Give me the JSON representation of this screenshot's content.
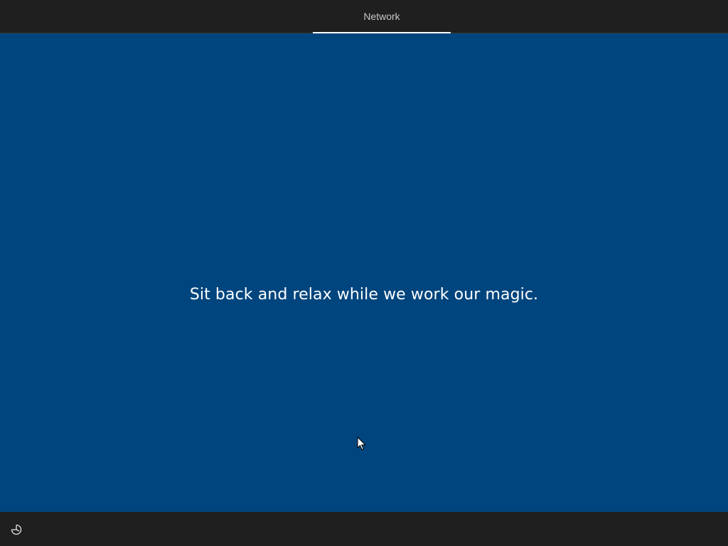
{
  "header": {
    "tabs": [
      {
        "label": "Network",
        "active": true
      }
    ]
  },
  "main": {
    "message": "Sit back and relax while we work our magic."
  },
  "footer": {
    "accessibility_icon": "ease-of-access-icon"
  },
  "colors": {
    "background": "#00457e",
    "bars": "#1f1f1f",
    "text": "#ffffff",
    "tab_text": "#c8c8c8"
  }
}
